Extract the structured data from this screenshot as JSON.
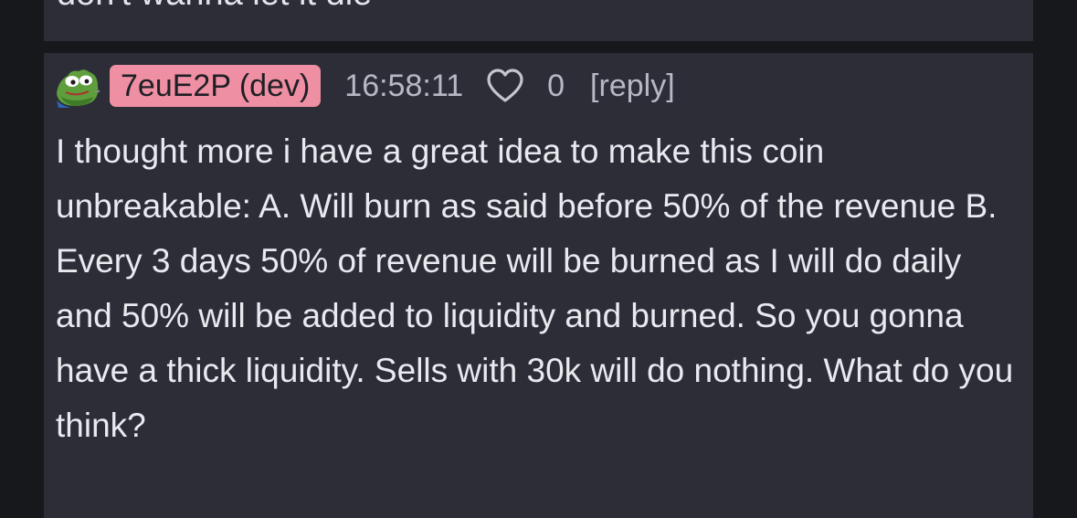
{
  "previous_comment": {
    "text": "don't wanna let it die"
  },
  "comment": {
    "username": "7euE2P (dev)",
    "time": "16:58:11",
    "likes": "0",
    "reply_label": "[reply]",
    "body": "I thought more i have a great idea to make this coin unbreakable: A. Will burn as said before 50% of the revenue B. Every 3 days 50% of revenue will be burned as I will do daily and 50% will be added to liquidity and burned. So you gonna have a thick liquidity. Sells with 30k will do nothing. What do you think?",
    "avatar_icon": "pepe-frog-avatar",
    "like_icon": "heart-outline-icon",
    "badge_color": "#ef8fa3"
  }
}
